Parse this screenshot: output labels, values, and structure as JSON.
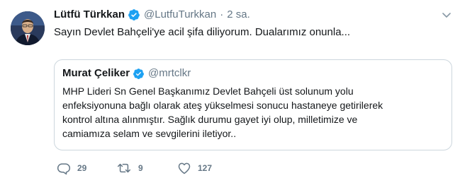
{
  "tweet": {
    "author_name": "Lütfü Türkkan",
    "author_handle": "@LutfuTurkkan",
    "separator": "·",
    "time": "2 sa.",
    "text": "Sayın Devlet Bahçeli'ye acil şifa diliyorum. Dualarımız onunla..."
  },
  "quote": {
    "author_name": "Murat Çeliker",
    "author_handle": "@mrtclkr",
    "lines": [
      "MHP Lideri Sn Genel Başkanımız Devlet Bahçeli üst solunum yolu",
      "enfeksiyonuna bağlı olarak ateş yükselmesi sonucu hastaneye getirilerek",
      "kontrol altına alınmıştır. Sağlık durumu gayet iyi olup, milletimize ve",
      "camiamıza selam ve sevgilerini iletiyor.."
    ]
  },
  "actions": {
    "reply_count": "29",
    "retweet_count": "9",
    "like_count": "127"
  },
  "icons": {
    "verified": "verified-badge-icon",
    "caret": "chevron-down-icon",
    "reply": "reply-icon",
    "retweet": "retweet-icon",
    "like": "heart-icon"
  },
  "colors": {
    "verified": "#1da1f2",
    "muted": "#657786",
    "border": "#ccd6dd"
  }
}
